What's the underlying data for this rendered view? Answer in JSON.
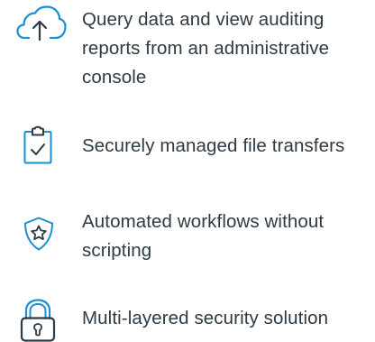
{
  "colors": {
    "icon_accent": "#1a8fd3",
    "text": "#2e3a44",
    "background": "#ffffff"
  },
  "features": [
    {
      "icon": "cloud-upload-icon",
      "text": "Query data and view auditing reports from an administrative console"
    },
    {
      "icon": "clipboard-check-icon",
      "text": "Securely managed file transfers"
    },
    {
      "icon": "shield-star-icon",
      "text": "Automated workflows without scripting"
    },
    {
      "icon": "padlock-icon",
      "text": "Multi-layered security solution"
    }
  ]
}
